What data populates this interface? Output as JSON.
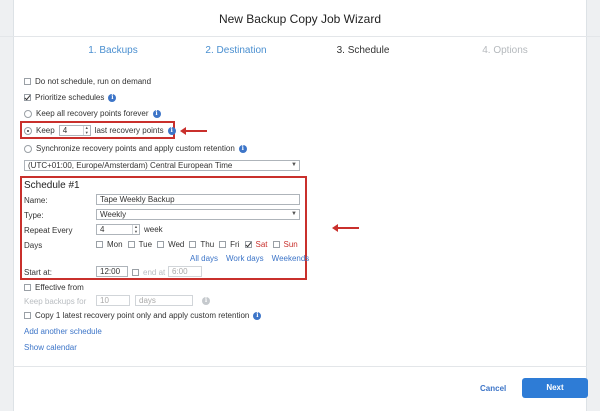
{
  "window": {
    "title": "New Backup Copy Job Wizard"
  },
  "steps": [
    {
      "label": "1. Backups",
      "state": "done"
    },
    {
      "label": "2. Destination",
      "state": "done"
    },
    {
      "label": "3. Schedule",
      "state": "active"
    },
    {
      "label": "4. Options",
      "state": "disabled"
    }
  ],
  "options": {
    "do_not_schedule": {
      "label": "Do not schedule, run on demand",
      "checked": false
    },
    "prioritize": {
      "label": "Prioritize schedules",
      "checked": true
    },
    "keep_all": {
      "label": "Keep all recovery points forever"
    },
    "keep_prefix": "Keep",
    "keep_value": "4",
    "keep_suffix": "last recovery points",
    "sync": {
      "label": "Synchronize recovery points and apply custom retention"
    },
    "timezone": "(UTC+01:00, Europe/Amsterdam) Central European Time"
  },
  "schedule": {
    "heading": "Schedule #1",
    "name_label": "Name:",
    "name_value": "Tape Weekly Backup",
    "type_label": "Type:",
    "type_value": "Weekly",
    "repeat_label": "Repeat Every",
    "repeat_value": "4",
    "repeat_unit": "week",
    "days_label": "Days",
    "days": [
      {
        "label": "Mon",
        "checked": false
      },
      {
        "label": "Tue",
        "checked": false
      },
      {
        "label": "Wed",
        "checked": false
      },
      {
        "label": "Thu",
        "checked": false
      },
      {
        "label": "Fri",
        "checked": false
      },
      {
        "label": "Sat",
        "checked": true
      },
      {
        "label": "Sun",
        "checked": false
      }
    ],
    "quick_links": [
      "All days",
      "Work days",
      "Weekends"
    ],
    "start_label": "Start at:",
    "start_value": "12:00",
    "end_label": "end at",
    "end_value": "6:00"
  },
  "effective_from": {
    "label": "Effective from"
  },
  "keep_backups": {
    "label": "Keep backups for",
    "value": "10",
    "unit": "days"
  },
  "copy_latest": {
    "label": "Copy 1 latest recovery point only and apply custom retention"
  },
  "links": {
    "add_schedule": "Add another schedule",
    "show_calendar": "Show calendar"
  },
  "footer": {
    "cancel": "Cancel",
    "next": "Next"
  },
  "colors": {
    "accent": "#2e7cd6",
    "highlight": "#c9302c",
    "link": "#3d75c8"
  }
}
